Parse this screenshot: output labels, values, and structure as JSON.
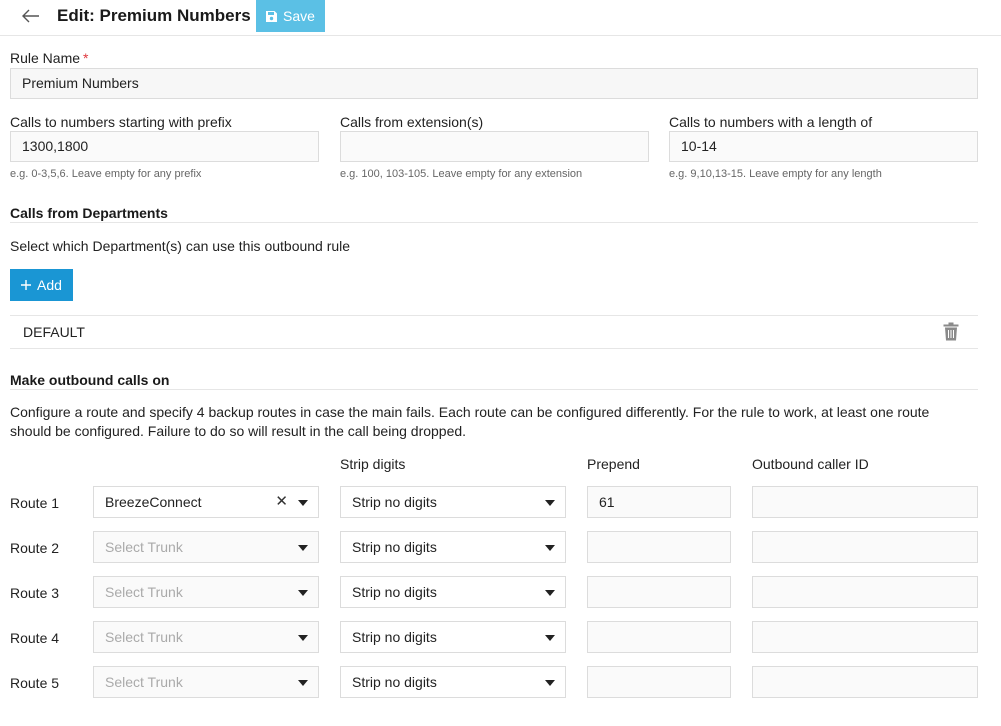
{
  "header": {
    "title": "Edit: Premium Numbers",
    "save_label": "Save"
  },
  "rule_name": {
    "label": "Rule Name",
    "required_mark": "*",
    "value": "Premium Numbers"
  },
  "prefix": {
    "label": "Calls to numbers starting with prefix",
    "value": "1300,1800",
    "hint": "e.g. 0-3,5,6. Leave empty for any prefix"
  },
  "extensions": {
    "label": "Calls from extension(s)",
    "value": "",
    "hint": "e.g. 100, 103-105. Leave empty for any extension"
  },
  "length": {
    "label": "Calls to numbers with a length of",
    "value": "10-14",
    "hint": "e.g. 9,10,13-15. Leave empty for any length"
  },
  "departments": {
    "title": "Calls from Departments",
    "description": "Select which Department(s) can use this outbound rule",
    "add_label": "Add",
    "items": [
      "DEFAULT"
    ]
  },
  "outbound": {
    "title": "Make outbound calls on",
    "description": "Configure a route and specify 4 backup routes in case the main fails. Each route can be configured differently. For the rule to work, at least one route should be configured. Failure to do so will result in the call being dropped.",
    "columns": {
      "strip": "Strip digits",
      "prepend": "Prepend",
      "caller_id": "Outbound caller ID"
    },
    "routes": [
      {
        "label": "Route 1",
        "trunk": "BreezeConnect",
        "trunk_placeholder": "",
        "strip": "Strip no digits",
        "prepend": "61",
        "caller_id": ""
      },
      {
        "label": "Route 2",
        "trunk": "",
        "trunk_placeholder": "Select Trunk",
        "strip": "Strip no digits",
        "prepend": "",
        "caller_id": ""
      },
      {
        "label": "Route 3",
        "trunk": "",
        "trunk_placeholder": "Select Trunk",
        "strip": "Strip no digits",
        "prepend": "",
        "caller_id": ""
      },
      {
        "label": "Route 4",
        "trunk": "",
        "trunk_placeholder": "Select Trunk",
        "strip": "Strip no digits",
        "prepend": "",
        "caller_id": ""
      },
      {
        "label": "Route 5",
        "trunk": "",
        "trunk_placeholder": "Select Trunk",
        "strip": "Strip no digits",
        "prepend": "",
        "caller_id": ""
      }
    ]
  },
  "icons": {
    "back": "arrow-left-icon",
    "save": "floppy-disk-icon",
    "add": "plus-icon",
    "delete": "trash-icon",
    "clear": "close-icon",
    "dropdown": "caret-down-icon"
  },
  "colors": {
    "save_button": "#5bc0e5",
    "add_button": "#1a96d4",
    "required": "#e0383e"
  }
}
